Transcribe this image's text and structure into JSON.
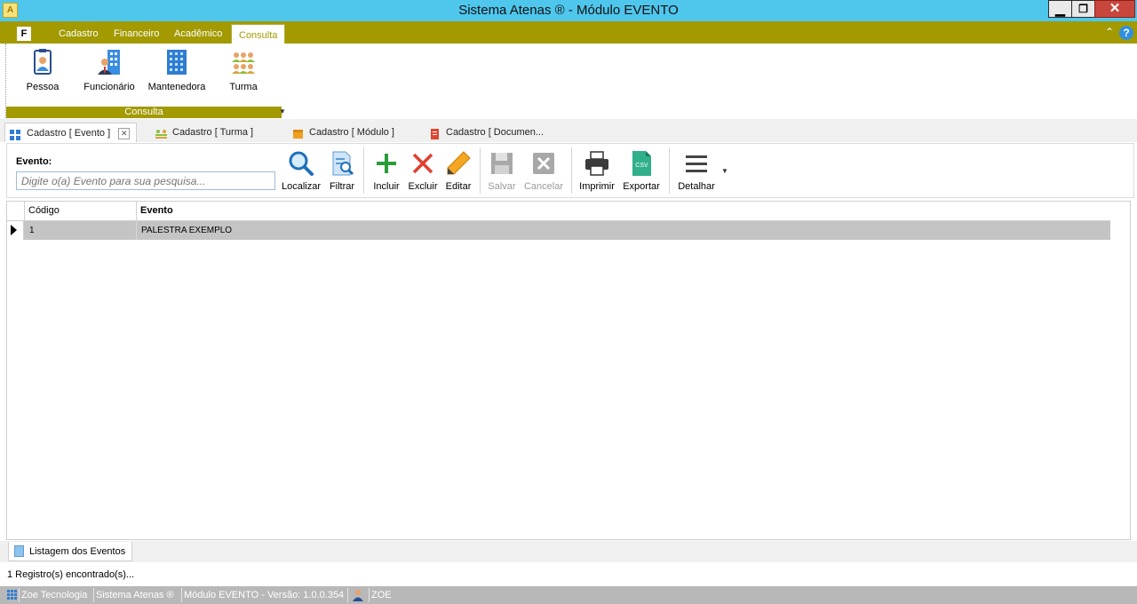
{
  "window": {
    "title": "Sistema Atenas ® - Módulo EVENTO",
    "app_icon_text": "A"
  },
  "ribbon": {
    "file_tab": "F",
    "tabs": [
      {
        "label": "Cadastro",
        "active": false
      },
      {
        "label": "Financeiro",
        "active": false
      },
      {
        "label": "Acadêmico",
        "active": false
      },
      {
        "label": "Consulta",
        "active": true
      }
    ],
    "group": {
      "label": "Consulta",
      "buttons": [
        {
          "label": "Pessoa",
          "icon": "person-id-card-icon"
        },
        {
          "label": "Funcionário",
          "icon": "employee-building-icon"
        },
        {
          "label": "Mantenedora",
          "icon": "building-icon"
        },
        {
          "label": "Turma",
          "icon": "group-people-icon"
        }
      ]
    }
  },
  "doc_tabs": [
    {
      "label": "Cadastro [ Evento ]",
      "active": true,
      "icon": "event-grid-icon"
    },
    {
      "label": "Cadastro [ Turma ]",
      "active": false,
      "icon": "group-people-icon"
    },
    {
      "label": "Cadastro [ Módulo ]",
      "active": false,
      "icon": "box-icon"
    },
    {
      "label": "Cadastro [ Documen...",
      "active": false,
      "icon": "document-icon"
    }
  ],
  "toolbar": {
    "search_label": "Evento:",
    "search_placeholder": "Digite o(a) Evento para sua pesquisa...",
    "buttons": {
      "localizar": "Localizar",
      "filtrar": "Filtrar",
      "incluir": "Incluir",
      "excluir": "Excluir",
      "editar": "Editar",
      "salvar": "Salvar",
      "cancelar": "Cancelar",
      "imprimir": "Imprimir",
      "exportar": "Exportar",
      "detalhar": "Detalhar"
    },
    "csv_badge": "CSV"
  },
  "grid": {
    "columns": [
      "Código",
      "Evento"
    ],
    "rows": [
      {
        "codigo": "1",
        "evento": "PALESTRA EXEMPLO"
      }
    ]
  },
  "bottom_tab": {
    "label": "Listagem dos Eventos"
  },
  "records_text": "1 Registro(s) encontrado(s)...",
  "status_bar": {
    "company": "Zoe Tecnologia",
    "system": "Sistema Atenas ®",
    "module": "Módulo EVENTO - Versão: 1.0.0.354",
    "user": "ZOE"
  },
  "colors": {
    "titlebar": "#4fc6ec",
    "ribbon_accent": "#a29a00",
    "selected_row": "#c4c4c4",
    "statusbar": "#b8b8b8"
  }
}
